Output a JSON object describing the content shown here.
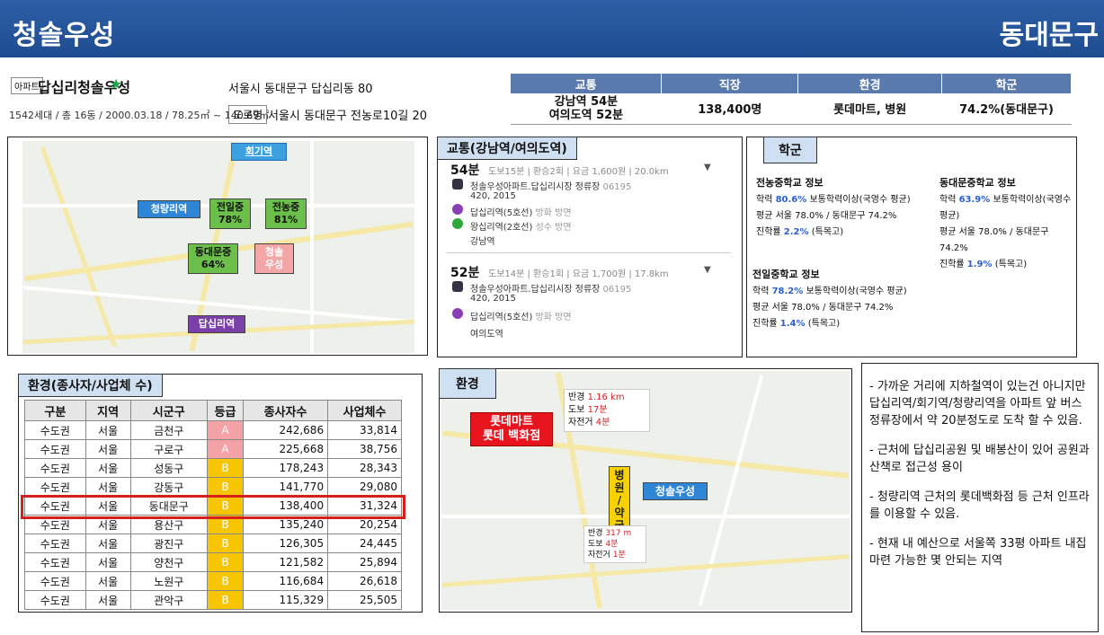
{
  "header": {
    "title": "청솔우성",
    "district": "동대문구"
  },
  "apt": {
    "badge": "아파트",
    "name": "답십리청솔우성",
    "star": "★",
    "meta": "1542세대 / 총 16동 / 2000.03.18 / 78.25㎡ ~ 140.69㎡",
    "address": "서울시 동대문구 답십리동 80",
    "road_badge": "도로명",
    "road_address": "서울시 동대문구 전농로10길 20"
  },
  "summary": {
    "headers": [
      "교통",
      "직장",
      "환경",
      "학군"
    ],
    "traffic_1": "강남역 54분",
    "traffic_2": "여의도역 52분",
    "jobs": "138,400명",
    "env": "롯데마트, 병원",
    "school": "74.2%(동대문구)"
  },
  "map1": {
    "labels": [
      "회기역",
      "청량리역",
      "답십리역",
      "청솔\n우성"
    ],
    "schools": [
      {
        "name": "전일중",
        "pct": "78%"
      },
      {
        "name": "전농중",
        "pct": "81%"
      },
      {
        "name": "동대문중",
        "pct": "64%"
      }
    ]
  },
  "traffic": {
    "title": "교통(강남역/여의도역)",
    "r1": {
      "time": "54분",
      "detail": "도보15분 | 환승2회 | 요금 1,600원 | 20.0km",
      "stop": "청솔우성아파트.답십리시장 정류장",
      "stop_no": "06195",
      "bus": "420, 2015",
      "s1": "답십리역(5호선)",
      "s1d": "방화 방면",
      "s2": "왕십리역(2호선)",
      "s2d": "성수 방면",
      "s3": "강남역"
    },
    "r2": {
      "time": "52분",
      "detail": "도보14분 | 환승1회 | 요금 1,700원 | 17.8km",
      "stop": "청솔우성아파트.답십리시장 정류장",
      "stop_no": "06195",
      "bus": "420, 2015",
      "s1": "답십리역(5호선)",
      "s1d": "방화 방면",
      "s2": "여의도역"
    }
  },
  "school": {
    "title": "학군",
    "a": {
      "name": "전농중학교 정보",
      "l1a": "학력",
      "l1b": "80.6%",
      "l1c": "보통학력이상(국영수 평균)",
      "l2": "평균 서울 78.0% / 동대문구 74.2%",
      "l3a": "진학률",
      "l3b": "2.2%",
      "l3c": "(특목고)"
    },
    "b": {
      "name": "동대문중학교 정보",
      "l1a": "학력",
      "l1b": "63.9%",
      "l1c": "보통학력이상(국영수 평균)",
      "l2": "평균 서울 78.0% / 동대문구 74.2%",
      "l3a": "진학률",
      "l3b": "1.9%",
      "l3c": "(특목고)"
    },
    "c": {
      "name": "전일중학교 정보",
      "l1a": "학력",
      "l1b": "78.2%",
      "l1c": "보통학력이상(국영수 평균)",
      "l2": "평균 서울 78.0% / 동대문구 74.2%",
      "l3a": "진학률",
      "l3b": "1.4%",
      "l3c": "(특목고)"
    }
  },
  "employment": {
    "title": "환경(종사자/사업체 수)",
    "headers": [
      "구분",
      "지역",
      "시군구",
      "등급",
      "종사자수",
      "사업체수"
    ],
    "rows": [
      [
        "수도권",
        "서울",
        "금천구",
        "A",
        "242,686",
        "33,814"
      ],
      [
        "수도권",
        "서울",
        "구로구",
        "A",
        "225,668",
        "38,756"
      ],
      [
        "수도권",
        "서울",
        "성동구",
        "B",
        "178,243",
        "28,343"
      ],
      [
        "수도권",
        "서울",
        "강동구",
        "B",
        "141,770",
        "29,080"
      ],
      [
        "수도권",
        "서울",
        "동대문구",
        "B",
        "138,400",
        "31,324"
      ],
      [
        "수도권",
        "서울",
        "용산구",
        "B",
        "135,240",
        "20,254"
      ],
      [
        "수도권",
        "서울",
        "광진구",
        "B",
        "126,305",
        "24,445"
      ],
      [
        "수도권",
        "서울",
        "양천구",
        "B",
        "121,582",
        "25,894"
      ],
      [
        "수도권",
        "서울",
        "노원구",
        "B",
        "116,684",
        "26,618"
      ],
      [
        "수도권",
        "서울",
        "관악구",
        "B",
        "115,329",
        "25,505"
      ]
    ]
  },
  "env": {
    "title": "환경",
    "radius_label": "반경",
    "radius": "1.16 km",
    "walk_label": "도보",
    "walk": "17분",
    "bike_label": "자전거",
    "bike": "4분",
    "mart": "롯데마트\n롯데 백화점",
    "hospital": "병\n원\n/\n약\n국",
    "apt": "청솔우성",
    "r2": "317 m",
    "w2": "4분",
    "b2": "1분"
  },
  "notes": [
    "- 가까운 거리에 지하철역이 있는건 아니지만 답십리역/회기역/청량리역을 아파트 앞 버스정류장에서 약 20분정도로 도착 할 수 있음.",
    "- 근처에 답십리공원 및 배봉산이 있어 공원과 산책로 접근성 용이",
    "- 청량리역 근처의 롯데백화점 등 근처 인프라를 이용할 수 있음.",
    "- 현재 내 예산으로 서울쪽 33평 아파트 내집마련 가능한 몇 안되는 지역"
  ]
}
